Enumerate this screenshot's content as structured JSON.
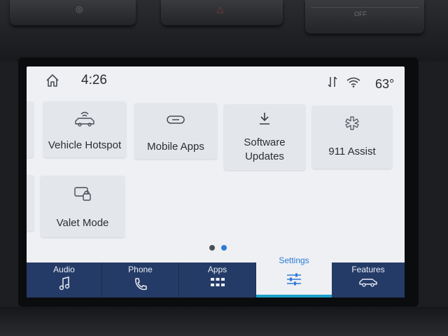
{
  "status": {
    "time": "4:26",
    "temperature": "63°"
  },
  "tiles": {
    "vehicle_hotspot": "Vehicle Hotspot",
    "mobile_apps": "Mobile Apps",
    "software_updates_line1": "Software",
    "software_updates_line2": "Updates",
    "assist_911": "911 Assist",
    "valet_mode": "Valet Mode"
  },
  "pagination": {
    "pages": 2,
    "current": 2
  },
  "nav": {
    "audio": "Audio",
    "phone": "Phone",
    "apps": "Apps",
    "settings": "Settings",
    "features": "Features",
    "active": "settings"
  },
  "hardware": {
    "off_label": "OFF"
  },
  "colors": {
    "nav_background": "#253b67",
    "active_accent": "#2d7ad6",
    "screen_background": "#eef0f3"
  },
  "icons": {
    "home": "home-icon",
    "sort": "sort-arrows-icon",
    "wifi": "wifi-icon",
    "hotspot": "car-wifi-icon",
    "mobile_apps": "link-icon",
    "software_updates": "download-icon",
    "assist_911": "medical-star-icon",
    "valet": "valet-lock-icon",
    "audio": "music-note-icon",
    "phone": "phone-handset-icon",
    "apps": "grid-icon",
    "settings": "sliders-icon",
    "features": "car-icon"
  }
}
